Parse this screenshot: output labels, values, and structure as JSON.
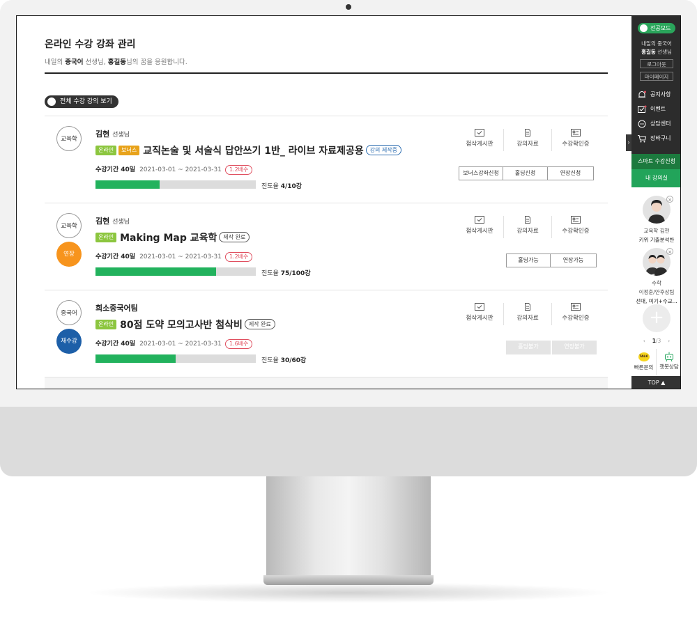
{
  "page": {
    "title": "온라인 수강 강좌 관리",
    "subtitle": {
      "prefix": "내일의 ",
      "subject": "중국어",
      "middle": " 선생님, ",
      "name": "홍길동",
      "suffix": "님의 꿈을 응원합니다."
    },
    "all_courses_button": "전체 수강 강의 보기"
  },
  "actions": {
    "board": "첨삭게시판",
    "materials": "강의자료",
    "certificate": "수강확인증"
  },
  "courses": [
    {
      "category": "교육학",
      "status_badge": "",
      "teacher": "김현",
      "teacher_suffix": "선생님",
      "tags": [
        "온라인",
        "보너스"
      ],
      "title": "교직논술 및 서술식 답안쓰기 1반_ 라이브 자료제공용",
      "state": "강의 제작중",
      "period_label": "수강기간 40일",
      "dates": "2021-03-01 ~ 2021-03-31",
      "speed": "1.2배수",
      "progress_label": "진도율",
      "progress_value": "4/10강",
      "progress_fraction": 0.4,
      "buttons": [
        "보너스강좌신청",
        "홀딩신청",
        "연장신청"
      ]
    },
    {
      "category": "교육학",
      "status_badge": "연장",
      "teacher": "김현",
      "teacher_suffix": "선생님",
      "tags": [
        "온라인"
      ],
      "title": "Making Map 교육학",
      "state": "제작 완료",
      "period_label": "수강기간 40일",
      "dates": "2021-03-01 ~ 2021-03-31",
      "speed": "1.2배수",
      "progress_label": "진도율",
      "progress_value": "75/100강",
      "progress_fraction": 0.75,
      "buttons": [
        "홀딩가능",
        "연장가능"
      ]
    },
    {
      "category": "중국어",
      "status_badge": "재수강",
      "teacher": "희소중국어팀",
      "teacher_suffix": "",
      "tags": [
        "온라인"
      ],
      "title": "80점 도약 모의고사반 첨삭비",
      "state": "제작 완료",
      "period_label": "수강기간 40일",
      "dates": "2021-03-01 ~ 2021-03-31",
      "speed": "1.6배수",
      "progress_label": "진도율",
      "progress_value": "30/60강",
      "progress_fraction": 0.5,
      "buttons": [
        "홀딩불가",
        "연장불가"
      ]
    }
  ],
  "sidebar": {
    "mode": "전공모드",
    "user_line1": "내일의 중국어",
    "user_name": "홍길동",
    "user_suffix": " 선생님",
    "logout": "로그아웃",
    "mypage": "마이페이지",
    "nav": [
      "공지사항",
      "이벤트",
      "상담센터",
      "장바구니"
    ],
    "smart_apply": "스마트 수강신청",
    "my_classroom": "내 강의실",
    "teachers": [
      {
        "line1": "교육학 김현",
        "line2": "키위 기출분석반"
      },
      {
        "line1": "수학",
        "line2": "이정훈/안후상팀",
        "line3": "선대, 미기+수교..."
      }
    ],
    "pager_current": "1",
    "pager_total": "/3",
    "quick_inquiry": "빠른문의",
    "chatbot": "챗봇상담",
    "talk_label": "TALK",
    "top": "TOP ▲"
  },
  "colors": {
    "accent_green": "#22b25d",
    "side_green": "#22a45a",
    "tag_green": "#8cc63f",
    "tag_gold": "#e8a31b",
    "orange": "#f7941d",
    "blue": "#1d5fa8",
    "speed_red": "#e04f5f"
  }
}
